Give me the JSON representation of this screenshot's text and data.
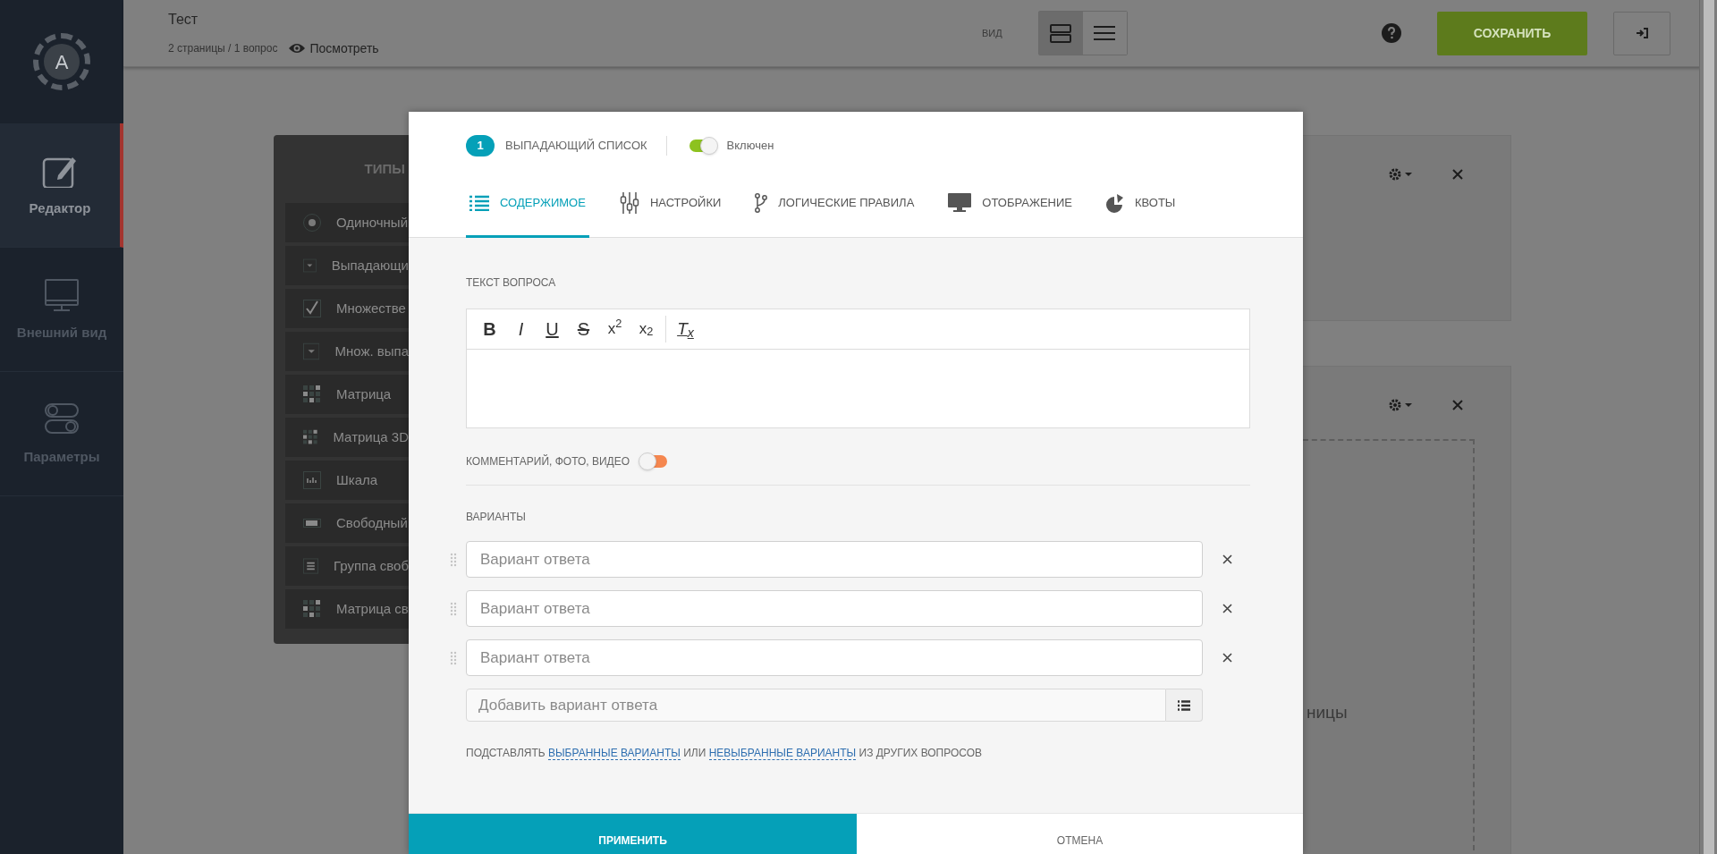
{
  "logo": {
    "letter": "A"
  },
  "sidebar": {
    "items": [
      {
        "label": "Редактор",
        "kind": "edit",
        "selected": true
      },
      {
        "label": "Внешний вид",
        "kind": "monitor",
        "selected": false
      },
      {
        "label": "Параметры",
        "kind": "toggles",
        "selected": false
      }
    ]
  },
  "topbar": {
    "title": "Тест",
    "subtitle": "2 страницы / 1 вопрос",
    "preview": "Посмотреть",
    "view_label": "ВИД",
    "view_modes": [
      {
        "kind": "cards",
        "selected": true
      },
      {
        "kind": "list",
        "selected": false
      }
    ],
    "save": "СОХРАНИТЬ"
  },
  "types_panel": {
    "title": "ТИПЫ",
    "items": [
      {
        "label": "Одиночный",
        "kind": "radio"
      },
      {
        "label": "Выпадающи",
        "kind": "dropdown"
      },
      {
        "label": "Множестве",
        "kind": "checkbox"
      },
      {
        "label": "Множ. выпа",
        "kind": "dropdown"
      },
      {
        "label": "Матрица",
        "kind": "matrix"
      },
      {
        "label": "Матрица 3D",
        "kind": "matrix"
      },
      {
        "label": "Шкала",
        "kind": "scale"
      },
      {
        "label": "Свободный",
        "kind": "text"
      },
      {
        "label": "Группа своб",
        "kind": "group"
      },
      {
        "label": "Матрица св",
        "kind": "matrix"
      }
    ]
  },
  "cards": [
    {
      "kind": "empty"
    },
    {
      "kind": "drop_zone",
      "drop_text": "ницы"
    }
  ],
  "modal": {
    "number": "1",
    "question_type": "ВЫПАДАЮЩИЙ СПИСОК",
    "enabled": {
      "label": "Включен",
      "on": true
    },
    "tabs": [
      {
        "label": "СОДЕРЖИМОЕ",
        "kind": "list",
        "selected": true
      },
      {
        "label": "НАСТРОЙКИ",
        "kind": "sliders",
        "selected": false
      },
      {
        "label": "ЛОГИЧЕСКИЕ ПРАВИЛА",
        "kind": "branch",
        "selected": false
      },
      {
        "label": "ОТОБРАЖЕНИЕ",
        "kind": "monitor",
        "selected": false
      },
      {
        "label": "КВОТЫ",
        "kind": "pie",
        "selected": false
      }
    ],
    "question_label": "ТЕКСТ ВОПРОСА",
    "toolbar": [
      {
        "label": "B",
        "kind": "bold"
      },
      {
        "label": "I",
        "kind": "italic"
      },
      {
        "label": "U",
        "kind": "underline"
      },
      {
        "label": "S",
        "kind": "strike"
      },
      {
        "label": "x$^{2}$",
        "kind": "sup"
      },
      {
        "label": "x$_{2}$",
        "kind": "sub"
      },
      {
        "label": "T$_{x}$",
        "kind": "clear"
      }
    ],
    "comment": {
      "label": "КОММЕНТАРИЙ, ФОТО, ВИДЕО",
      "on": false
    },
    "options_label": "ВАРИАНТЫ",
    "options": [
      {
        "placeholder": "Вариант ответа"
      },
      {
        "placeholder": "Вариант ответа"
      },
      {
        "placeholder": "Вариант ответа"
      }
    ],
    "add_placeholder": "Добавить вариант ответа",
    "substitute": {
      "prefix": "ПОДСТАВЛЯТЬ",
      "link_1": "ВЫБРАННЫЕ ВАРИАНТЫ",
      "middle": "ИЛИ",
      "link_2": "НЕВЫБРАННЫЕ ВАРИАНТЫ",
      "suffix": "ИЗ ДРУГИХ ВОПРОСОВ"
    },
    "apply": "ПРИМЕНИТЬ",
    "cancel": "ОТМЕНА"
  }
}
